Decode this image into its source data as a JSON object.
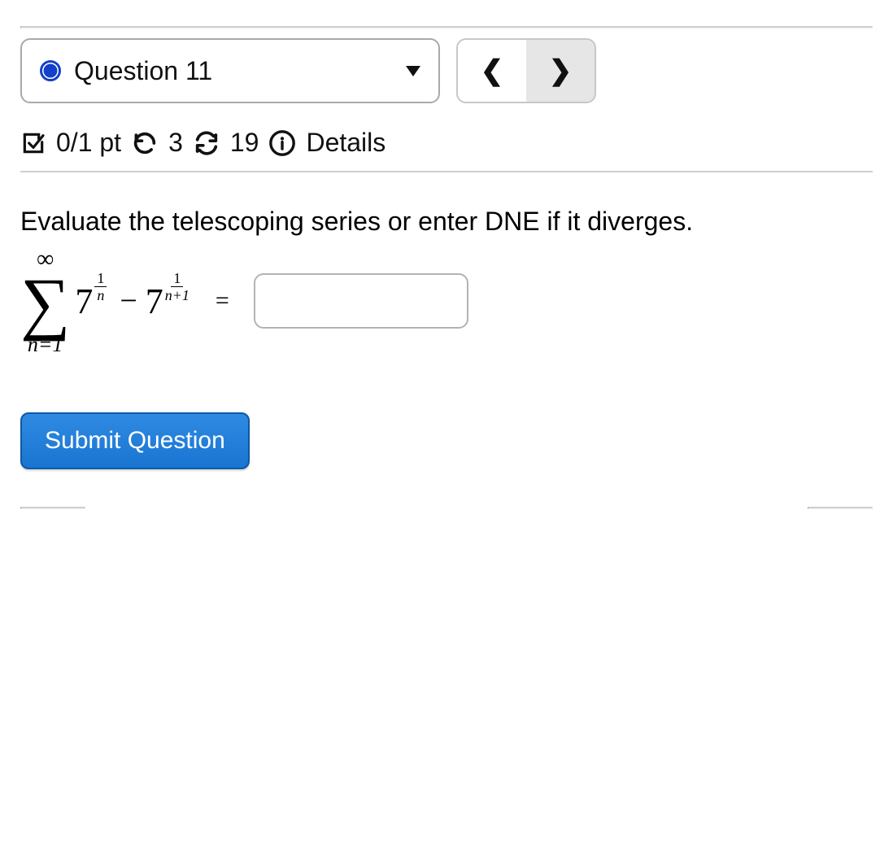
{
  "header": {
    "question_label": "Question 11"
  },
  "meta": {
    "points": "0/1 pt",
    "retries": "3",
    "reattempts": "19",
    "details_label": "Details"
  },
  "problem": {
    "prompt": "Evaluate the telescoping series or enter DNE if it diverges.",
    "series": {
      "upper": "∞",
      "lower": "n=1",
      "term1_base": "7",
      "term1_num": "1",
      "term1_den": "n",
      "minus": "−",
      "term2_base": "7",
      "term2_num": "1",
      "term2_den": "n+1"
    },
    "equals": "=",
    "answer_value": ""
  },
  "actions": {
    "submit_label": "Submit Question"
  }
}
